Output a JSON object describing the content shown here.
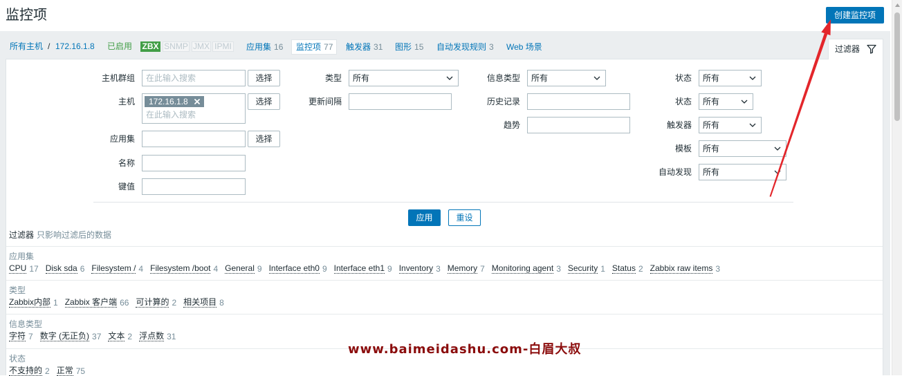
{
  "page": {
    "title": "监控项",
    "create_button": "创建监控项"
  },
  "breadcrumb": {
    "all_hosts": "所有主机",
    "separator": "/",
    "host": "172.16.1.8",
    "host_status": "已启用",
    "badges": [
      {
        "label": "ZBX",
        "active": true
      },
      {
        "label": "SNMP",
        "active": false
      },
      {
        "label": "JMX",
        "active": false
      },
      {
        "label": "IPMI",
        "active": false
      }
    ]
  },
  "nav": [
    {
      "label": "应用集",
      "count": 16
    },
    {
      "label": "监控项",
      "count": 77,
      "active": true
    },
    {
      "label": "触发器",
      "count": 31
    },
    {
      "label": "图形",
      "count": 15
    },
    {
      "label": "自动发现规则",
      "count": 3
    },
    {
      "label": "Web 场景"
    }
  ],
  "filter_tab": {
    "label": "过滤器",
    "icon": "funnel-icon"
  },
  "filter": {
    "host_groups": {
      "label": "主机群组",
      "value": "",
      "placeholder": "在此输入搜索",
      "select": "选择"
    },
    "hosts": {
      "label": "主机",
      "selected": "172.16.1.8",
      "placeholder": "在此输入搜索",
      "select": "选择"
    },
    "application": {
      "label": "应用集",
      "value": "",
      "select": "选择"
    },
    "name": {
      "label": "名称",
      "value": ""
    },
    "key": {
      "label": "键值",
      "value": ""
    },
    "type": {
      "label": "类型",
      "value": "所有"
    },
    "update_interval": {
      "label": "更新间隔",
      "value": ""
    },
    "value_type": {
      "label": "信息类型",
      "value": "所有"
    },
    "history": {
      "label": "历史记录",
      "value": ""
    },
    "trends": {
      "label": "趋势",
      "value": ""
    },
    "state": {
      "label": "状态",
      "value": "所有"
    },
    "status": {
      "label": "状态",
      "value": "所有"
    },
    "triggers": {
      "label": "触发器",
      "value": "所有"
    },
    "template": {
      "label": "模板",
      "value": "所有"
    },
    "discovery": {
      "label": "自动发现",
      "value": "所有"
    },
    "apply": "应用",
    "reset": "重设"
  },
  "subfilter": {
    "title": "过滤器",
    "hint": "只影响过滤后的数据",
    "groups": [
      {
        "label": "应用集",
        "items": [
          {
            "name": "CPU",
            "count": 17
          },
          {
            "name": "Disk sda",
            "count": 6
          },
          {
            "name": "Filesystem /",
            "count": 4
          },
          {
            "name": "Filesystem /boot",
            "count": 4
          },
          {
            "name": "General",
            "count": 9
          },
          {
            "name": "Interface eth0",
            "count": 9
          },
          {
            "name": "Interface eth1",
            "count": 9
          },
          {
            "name": "Inventory",
            "count": 3
          },
          {
            "name": "Memory",
            "count": 7
          },
          {
            "name": "Monitoring agent",
            "count": 3
          },
          {
            "name": "Security",
            "count": 1
          },
          {
            "name": "Status",
            "count": 2
          },
          {
            "name": "Zabbix raw items",
            "count": 3
          }
        ]
      },
      {
        "label": "类型",
        "items": [
          {
            "name": "Zabbix内部",
            "count": 1
          },
          {
            "name": "Zabbix 客户端",
            "count": 66
          },
          {
            "name": "可计算的",
            "count": 2
          },
          {
            "name": "相关项目",
            "count": 8
          }
        ]
      },
      {
        "label": "信息类型",
        "items": [
          {
            "name": "字符",
            "count": 7
          },
          {
            "name": "数字 (无正负)",
            "count": 37
          },
          {
            "name": "文本",
            "count": 2
          },
          {
            "name": "浮点数",
            "count": 31
          }
        ]
      },
      {
        "label": "状态",
        "items": [
          {
            "name": "不支持的",
            "count": 2
          },
          {
            "name": "正常",
            "count": 75
          }
        ]
      }
    ]
  },
  "watermark": "www.baimeidashu.com-白眉大叔",
  "icons": {
    "filter": "funnel-icon",
    "select": "chevron-down-icon",
    "tag_remove": "close-icon",
    "scroll": "scroll-up-arrow-icon"
  },
  "colors": {
    "primary": "#0275b8",
    "enabled": "#429e47",
    "muted": "#768d99",
    "text": "#1f2c33",
    "annotation_arrow": "#e3262b",
    "watermark": "#8b0c0c"
  }
}
